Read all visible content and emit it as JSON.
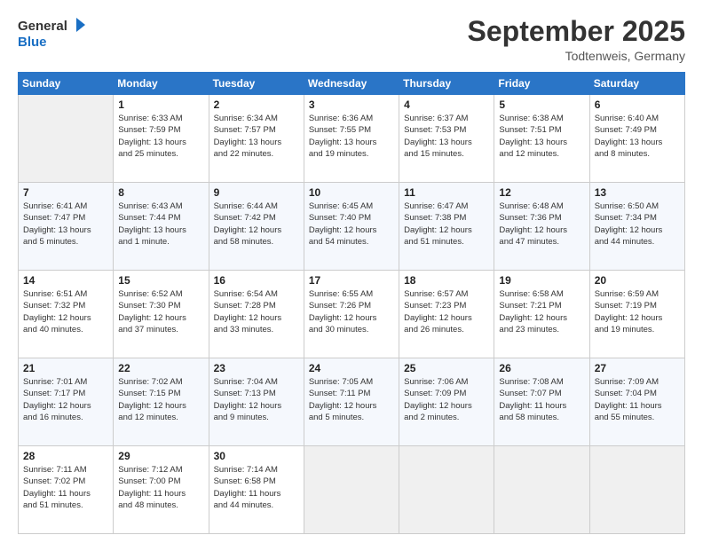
{
  "header": {
    "logo_line1": "General",
    "logo_line2": "Blue",
    "month": "September 2025",
    "location": "Todtenweis, Germany"
  },
  "days_of_week": [
    "Sunday",
    "Monday",
    "Tuesday",
    "Wednesday",
    "Thursday",
    "Friday",
    "Saturday"
  ],
  "weeks": [
    [
      {
        "day": "",
        "info": ""
      },
      {
        "day": "1",
        "info": "Sunrise: 6:33 AM\nSunset: 7:59 PM\nDaylight: 13 hours\nand 25 minutes."
      },
      {
        "day": "2",
        "info": "Sunrise: 6:34 AM\nSunset: 7:57 PM\nDaylight: 13 hours\nand 22 minutes."
      },
      {
        "day": "3",
        "info": "Sunrise: 6:36 AM\nSunset: 7:55 PM\nDaylight: 13 hours\nand 19 minutes."
      },
      {
        "day": "4",
        "info": "Sunrise: 6:37 AM\nSunset: 7:53 PM\nDaylight: 13 hours\nand 15 minutes."
      },
      {
        "day": "5",
        "info": "Sunrise: 6:38 AM\nSunset: 7:51 PM\nDaylight: 13 hours\nand 12 minutes."
      },
      {
        "day": "6",
        "info": "Sunrise: 6:40 AM\nSunset: 7:49 PM\nDaylight: 13 hours\nand 8 minutes."
      }
    ],
    [
      {
        "day": "7",
        "info": "Sunrise: 6:41 AM\nSunset: 7:47 PM\nDaylight: 13 hours\nand 5 minutes."
      },
      {
        "day": "8",
        "info": "Sunrise: 6:43 AM\nSunset: 7:44 PM\nDaylight: 13 hours\nand 1 minute."
      },
      {
        "day": "9",
        "info": "Sunrise: 6:44 AM\nSunset: 7:42 PM\nDaylight: 12 hours\nand 58 minutes."
      },
      {
        "day": "10",
        "info": "Sunrise: 6:45 AM\nSunset: 7:40 PM\nDaylight: 12 hours\nand 54 minutes."
      },
      {
        "day": "11",
        "info": "Sunrise: 6:47 AM\nSunset: 7:38 PM\nDaylight: 12 hours\nand 51 minutes."
      },
      {
        "day": "12",
        "info": "Sunrise: 6:48 AM\nSunset: 7:36 PM\nDaylight: 12 hours\nand 47 minutes."
      },
      {
        "day": "13",
        "info": "Sunrise: 6:50 AM\nSunset: 7:34 PM\nDaylight: 12 hours\nand 44 minutes."
      }
    ],
    [
      {
        "day": "14",
        "info": "Sunrise: 6:51 AM\nSunset: 7:32 PM\nDaylight: 12 hours\nand 40 minutes."
      },
      {
        "day": "15",
        "info": "Sunrise: 6:52 AM\nSunset: 7:30 PM\nDaylight: 12 hours\nand 37 minutes."
      },
      {
        "day": "16",
        "info": "Sunrise: 6:54 AM\nSunset: 7:28 PM\nDaylight: 12 hours\nand 33 minutes."
      },
      {
        "day": "17",
        "info": "Sunrise: 6:55 AM\nSunset: 7:26 PM\nDaylight: 12 hours\nand 30 minutes."
      },
      {
        "day": "18",
        "info": "Sunrise: 6:57 AM\nSunset: 7:23 PM\nDaylight: 12 hours\nand 26 minutes."
      },
      {
        "day": "19",
        "info": "Sunrise: 6:58 AM\nSunset: 7:21 PM\nDaylight: 12 hours\nand 23 minutes."
      },
      {
        "day": "20",
        "info": "Sunrise: 6:59 AM\nSunset: 7:19 PM\nDaylight: 12 hours\nand 19 minutes."
      }
    ],
    [
      {
        "day": "21",
        "info": "Sunrise: 7:01 AM\nSunset: 7:17 PM\nDaylight: 12 hours\nand 16 minutes."
      },
      {
        "day": "22",
        "info": "Sunrise: 7:02 AM\nSunset: 7:15 PM\nDaylight: 12 hours\nand 12 minutes."
      },
      {
        "day": "23",
        "info": "Sunrise: 7:04 AM\nSunset: 7:13 PM\nDaylight: 12 hours\nand 9 minutes."
      },
      {
        "day": "24",
        "info": "Sunrise: 7:05 AM\nSunset: 7:11 PM\nDaylight: 12 hours\nand 5 minutes."
      },
      {
        "day": "25",
        "info": "Sunrise: 7:06 AM\nSunset: 7:09 PM\nDaylight: 12 hours\nand 2 minutes."
      },
      {
        "day": "26",
        "info": "Sunrise: 7:08 AM\nSunset: 7:07 PM\nDaylight: 11 hours\nand 58 minutes."
      },
      {
        "day": "27",
        "info": "Sunrise: 7:09 AM\nSunset: 7:04 PM\nDaylight: 11 hours\nand 55 minutes."
      }
    ],
    [
      {
        "day": "28",
        "info": "Sunrise: 7:11 AM\nSunset: 7:02 PM\nDaylight: 11 hours\nand 51 minutes."
      },
      {
        "day": "29",
        "info": "Sunrise: 7:12 AM\nSunset: 7:00 PM\nDaylight: 11 hours\nand 48 minutes."
      },
      {
        "day": "30",
        "info": "Sunrise: 7:14 AM\nSunset: 6:58 PM\nDaylight: 11 hours\nand 44 minutes."
      },
      {
        "day": "",
        "info": ""
      },
      {
        "day": "",
        "info": ""
      },
      {
        "day": "",
        "info": ""
      },
      {
        "day": "",
        "info": ""
      }
    ]
  ]
}
